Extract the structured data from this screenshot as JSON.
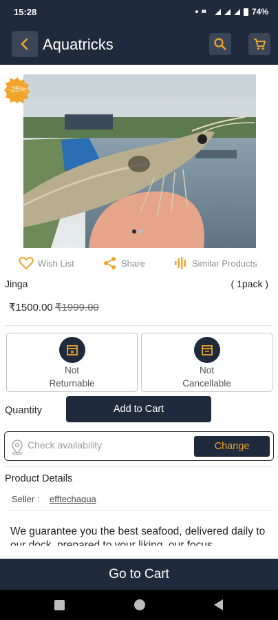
{
  "status_bar": {
    "time": "15:28",
    "battery": "74%"
  },
  "app_bar": {
    "title": "Aquatricks"
  },
  "product": {
    "discount": "-25%",
    "name": "Jinga",
    "pack": "( 1pack )",
    "price": "₹1500.00",
    "mrp": "₹1999.00",
    "image_count": 2,
    "image_active": 1
  },
  "actions": {
    "wishlist": "Wish List",
    "share": "Share",
    "similar": "Similar Products"
  },
  "policies": {
    "returnable": {
      "line1": "Not",
      "line2": "Returnable"
    },
    "cancellable": {
      "line1": "Not",
      "line2": "Cancellable"
    }
  },
  "quantity": {
    "label": "Quantity",
    "add_to_cart": "Add to Cart"
  },
  "availability": {
    "placeholder": "Check availability",
    "change": "Change"
  },
  "details": {
    "title": "Product Details",
    "seller_label": "Seller :",
    "seller": "efftechaqua",
    "description": "We guarantee you the best seafood, delivered daily to our dock, prepared to your liking, our focus"
  },
  "footer": {
    "go_to_cart": "Go to Cart"
  },
  "colors": {
    "primary": "#1f2a3c",
    "accent": "#f2a52a"
  }
}
